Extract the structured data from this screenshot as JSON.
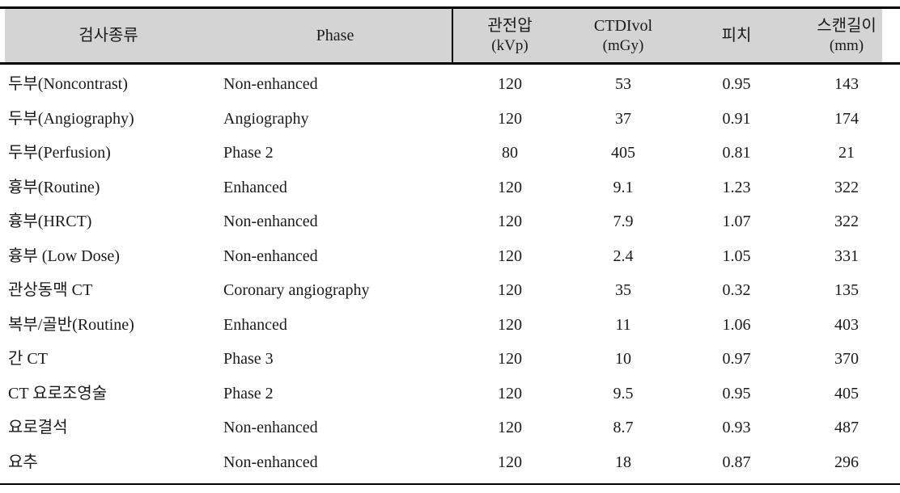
{
  "table": {
    "caption": "",
    "columns": [
      {
        "key": "exam",
        "label": "검사종류",
        "unit": "",
        "align": "left"
      },
      {
        "key": "phase",
        "label": "Phase",
        "unit": "",
        "align": "left"
      },
      {
        "key": "kvp",
        "label": "관전압",
        "unit": "(kVp)",
        "align": "center"
      },
      {
        "key": "ctdi",
        "label": "CTDIvol",
        "unit": "(mGy)",
        "align": "center"
      },
      {
        "key": "pitch",
        "label": "피치",
        "unit": "",
        "align": "center"
      },
      {
        "key": "len",
        "label": "스캔길이",
        "unit": "(mm)",
        "align": "center"
      }
    ],
    "rows": [
      {
        "exam": "두부(Noncontrast)",
        "phase": "Non-enhanced",
        "kvp": "120",
        "ctdi": "53",
        "pitch": "0.95",
        "len": "143"
      },
      {
        "exam": "두부(Angiography)",
        "phase": "Angiography",
        "kvp": "120",
        "ctdi": "37",
        "pitch": "0.91",
        "len": "174"
      },
      {
        "exam": "두부(Perfusion)",
        "phase": "Phase 2",
        "kvp": "80",
        "ctdi": "405",
        "pitch": "0.81",
        "len": "21"
      },
      {
        "exam": "흉부(Routine)",
        "phase": "Enhanced",
        "kvp": "120",
        "ctdi": "9.1",
        "pitch": "1.23",
        "len": "322"
      },
      {
        "exam": "흉부(HRCT)",
        "phase": "Non-enhanced",
        "kvp": "120",
        "ctdi": "7.9",
        "pitch": "1.07",
        "len": "322"
      },
      {
        "exam": "흉부 (Low Dose)",
        "phase": "Non-enhanced",
        "kvp": "120",
        "ctdi": "2.4",
        "pitch": "1.05",
        "len": "331"
      },
      {
        "exam": "관상동맥 CT",
        "phase": "Coronary angiography",
        "kvp": "120",
        "ctdi": "35",
        "pitch": "0.32",
        "len": "135"
      },
      {
        "exam": "복부/골반(Routine)",
        "phase": "Enhanced",
        "kvp": "120",
        "ctdi": "11",
        "pitch": "1.06",
        "len": "403"
      },
      {
        "exam": "간 CT",
        "phase": "Phase 3",
        "kvp": "120",
        "ctdi": "10",
        "pitch": "0.97",
        "len": "370"
      },
      {
        "exam": "CT 요로조영술",
        "phase": "Phase 2",
        "kvp": "120",
        "ctdi": "9.5",
        "pitch": "0.95",
        "len": "405"
      },
      {
        "exam": "요로결석",
        "phase": "Non-enhanced",
        "kvp": "120",
        "ctdi": "8.7",
        "pitch": "0.93",
        "len": "487"
      },
      {
        "exam": "요추",
        "phase": "Non-enhanced",
        "kvp": "120",
        "ctdi": "18",
        "pitch": "0.87",
        "len": "296"
      }
    ]
  },
  "style": {
    "header_background": "#d4d4d4",
    "rule_color": "#000000",
    "text_color": "#1a1a1a",
    "page_background": "#ffffff"
  }
}
